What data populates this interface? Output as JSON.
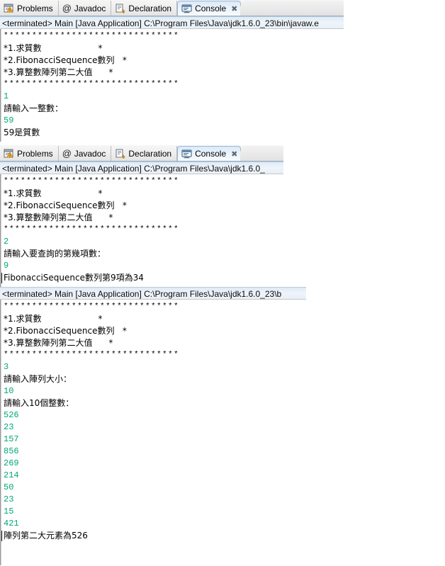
{
  "tabs": [
    {
      "label": "Problems",
      "icon": "problems-icon",
      "active": false
    },
    {
      "label": "Javadoc",
      "icon": "javadoc-icon",
      "active": false
    },
    {
      "label": "Declaration",
      "icon": "declaration-icon",
      "active": false
    },
    {
      "label": "Console",
      "icon": "console-icon",
      "active": true,
      "close": "✖"
    }
  ],
  "colors": {
    "input_green": "#00a878",
    "output_black": "#000000",
    "active_tab_blue": "#dce9f7",
    "process_line_bg": "#dfeaf6"
  },
  "panels": [
    {
      "name": "console-panel-prime",
      "has_tabstrip": true,
      "process_line": "<terminated> Main [Java Application] C:\\Program Files\\Java\\jdk1.6.0_23\\bin\\javaw.e",
      "lines": [
        {
          "text": "*******************************",
          "kind": "stars"
        },
        {
          "text": "*1.求質數                     *",
          "kind": "menu"
        },
        {
          "text": "*2.FibonacciSequence數列   *",
          "kind": "menu"
        },
        {
          "text": "*3.算整數陣列第二大值      *",
          "kind": "menu"
        },
        {
          "text": "*******************************",
          "kind": "stars"
        },
        {
          "text": "1",
          "kind": "in"
        },
        {
          "text": "請輸入一整數：",
          "kind": "out"
        },
        {
          "text": "59",
          "kind": "in"
        },
        {
          "text": "59是質數",
          "kind": "out"
        }
      ]
    },
    {
      "name": "console-panel-fibonacci",
      "has_tabstrip": true,
      "process_line": "<terminated> Main [Java Application] C:\\Program Files\\Java\\jdk1.6.0_",
      "lines": [
        {
          "text": "*******************************",
          "kind": "stars"
        },
        {
          "text": "*1.求質數                     *",
          "kind": "menu"
        },
        {
          "text": "*2.FibonacciSequence數列   *",
          "kind": "menu"
        },
        {
          "text": "*3.算整數陣列第二大值      *",
          "kind": "menu"
        },
        {
          "text": "*******************************",
          "kind": "stars"
        },
        {
          "text": "2",
          "kind": "in"
        },
        {
          "text": "請輸入要查詢的第幾項數：",
          "kind": "out"
        },
        {
          "text": "9",
          "kind": "in"
        },
        {
          "text": "FibonacciSequence數列第9項為34",
          "kind": "out-caret"
        }
      ]
    },
    {
      "name": "console-panel-second-largest",
      "has_tabstrip": false,
      "process_line": "<terminated> Main [Java Application] C:\\Program Files\\Java\\jdk1.6.0_23\\b",
      "lines": [
        {
          "text": "*******************************",
          "kind": "stars"
        },
        {
          "text": "*1.求質數                     *",
          "kind": "menu"
        },
        {
          "text": "*2.FibonacciSequence數列   *",
          "kind": "menu"
        },
        {
          "text": "*3.算整數陣列第二大值      *",
          "kind": "menu"
        },
        {
          "text": "*******************************",
          "kind": "stars"
        },
        {
          "text": "3",
          "kind": "in"
        },
        {
          "text": "請輸入陣列大小：",
          "kind": "out"
        },
        {
          "text": "10",
          "kind": "in"
        },
        {
          "text": "請輸入10個整數：",
          "kind": "out"
        },
        {
          "text": "526",
          "kind": "in"
        },
        {
          "text": "23",
          "kind": "in"
        },
        {
          "text": "157",
          "kind": "in"
        },
        {
          "text": "856",
          "kind": "in"
        },
        {
          "text": "269",
          "kind": "in"
        },
        {
          "text": "214",
          "kind": "in"
        },
        {
          "text": "50",
          "kind": "in"
        },
        {
          "text": "23",
          "kind": "in"
        },
        {
          "text": "15",
          "kind": "in"
        },
        {
          "text": "421",
          "kind": "in"
        },
        {
          "text": "陣列第二大元素為526",
          "kind": "out-caret"
        }
      ]
    }
  ]
}
